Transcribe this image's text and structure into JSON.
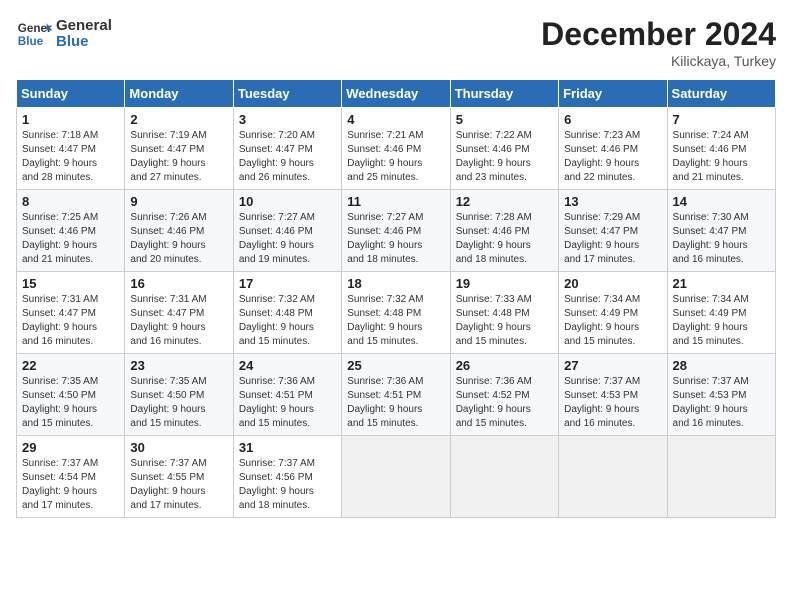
{
  "header": {
    "logo_line1": "General",
    "logo_line2": "Blue",
    "month": "December 2024",
    "location": "Kilickaya, Turkey"
  },
  "weekdays": [
    "Sunday",
    "Monday",
    "Tuesday",
    "Wednesday",
    "Thursday",
    "Friday",
    "Saturday"
  ],
  "weeks": [
    [
      {
        "day": "1",
        "info": "Sunrise: 7:18 AM\nSunset: 4:47 PM\nDaylight: 9 hours\nand 28 minutes."
      },
      {
        "day": "2",
        "info": "Sunrise: 7:19 AM\nSunset: 4:47 PM\nDaylight: 9 hours\nand 27 minutes."
      },
      {
        "day": "3",
        "info": "Sunrise: 7:20 AM\nSunset: 4:47 PM\nDaylight: 9 hours\nand 26 minutes."
      },
      {
        "day": "4",
        "info": "Sunrise: 7:21 AM\nSunset: 4:46 PM\nDaylight: 9 hours\nand 25 minutes."
      },
      {
        "day": "5",
        "info": "Sunrise: 7:22 AM\nSunset: 4:46 PM\nDaylight: 9 hours\nand 23 minutes."
      },
      {
        "day": "6",
        "info": "Sunrise: 7:23 AM\nSunset: 4:46 PM\nDaylight: 9 hours\nand 22 minutes."
      },
      {
        "day": "7",
        "info": "Sunrise: 7:24 AM\nSunset: 4:46 PM\nDaylight: 9 hours\nand 21 minutes."
      }
    ],
    [
      {
        "day": "8",
        "info": "Sunrise: 7:25 AM\nSunset: 4:46 PM\nDaylight: 9 hours\nand 21 minutes."
      },
      {
        "day": "9",
        "info": "Sunrise: 7:26 AM\nSunset: 4:46 PM\nDaylight: 9 hours\nand 20 minutes."
      },
      {
        "day": "10",
        "info": "Sunrise: 7:27 AM\nSunset: 4:46 PM\nDaylight: 9 hours\nand 19 minutes."
      },
      {
        "day": "11",
        "info": "Sunrise: 7:27 AM\nSunset: 4:46 PM\nDaylight: 9 hours\nand 18 minutes."
      },
      {
        "day": "12",
        "info": "Sunrise: 7:28 AM\nSunset: 4:46 PM\nDaylight: 9 hours\nand 18 minutes."
      },
      {
        "day": "13",
        "info": "Sunrise: 7:29 AM\nSunset: 4:47 PM\nDaylight: 9 hours\nand 17 minutes."
      },
      {
        "day": "14",
        "info": "Sunrise: 7:30 AM\nSunset: 4:47 PM\nDaylight: 9 hours\nand 16 minutes."
      }
    ],
    [
      {
        "day": "15",
        "info": "Sunrise: 7:31 AM\nSunset: 4:47 PM\nDaylight: 9 hours\nand 16 minutes."
      },
      {
        "day": "16",
        "info": "Sunrise: 7:31 AM\nSunset: 4:47 PM\nDaylight: 9 hours\nand 16 minutes."
      },
      {
        "day": "17",
        "info": "Sunrise: 7:32 AM\nSunset: 4:48 PM\nDaylight: 9 hours\nand 15 minutes."
      },
      {
        "day": "18",
        "info": "Sunrise: 7:32 AM\nSunset: 4:48 PM\nDaylight: 9 hours\nand 15 minutes."
      },
      {
        "day": "19",
        "info": "Sunrise: 7:33 AM\nSunset: 4:48 PM\nDaylight: 9 hours\nand 15 minutes."
      },
      {
        "day": "20",
        "info": "Sunrise: 7:34 AM\nSunset: 4:49 PM\nDaylight: 9 hours\nand 15 minutes."
      },
      {
        "day": "21",
        "info": "Sunrise: 7:34 AM\nSunset: 4:49 PM\nDaylight: 9 hours\nand 15 minutes."
      }
    ],
    [
      {
        "day": "22",
        "info": "Sunrise: 7:35 AM\nSunset: 4:50 PM\nDaylight: 9 hours\nand 15 minutes."
      },
      {
        "day": "23",
        "info": "Sunrise: 7:35 AM\nSunset: 4:50 PM\nDaylight: 9 hours\nand 15 minutes."
      },
      {
        "day": "24",
        "info": "Sunrise: 7:36 AM\nSunset: 4:51 PM\nDaylight: 9 hours\nand 15 minutes."
      },
      {
        "day": "25",
        "info": "Sunrise: 7:36 AM\nSunset: 4:51 PM\nDaylight: 9 hours\nand 15 minutes."
      },
      {
        "day": "26",
        "info": "Sunrise: 7:36 AM\nSunset: 4:52 PM\nDaylight: 9 hours\nand 15 minutes."
      },
      {
        "day": "27",
        "info": "Sunrise: 7:37 AM\nSunset: 4:53 PM\nDaylight: 9 hours\nand 16 minutes."
      },
      {
        "day": "28",
        "info": "Sunrise: 7:37 AM\nSunset: 4:53 PM\nDaylight: 9 hours\nand 16 minutes."
      }
    ],
    [
      {
        "day": "29",
        "info": "Sunrise: 7:37 AM\nSunset: 4:54 PM\nDaylight: 9 hours\nand 17 minutes."
      },
      {
        "day": "30",
        "info": "Sunrise: 7:37 AM\nSunset: 4:55 PM\nDaylight: 9 hours\nand 17 minutes."
      },
      {
        "day": "31",
        "info": "Sunrise: 7:37 AM\nSunset: 4:56 PM\nDaylight: 9 hours\nand 18 minutes."
      },
      null,
      null,
      null,
      null
    ]
  ]
}
